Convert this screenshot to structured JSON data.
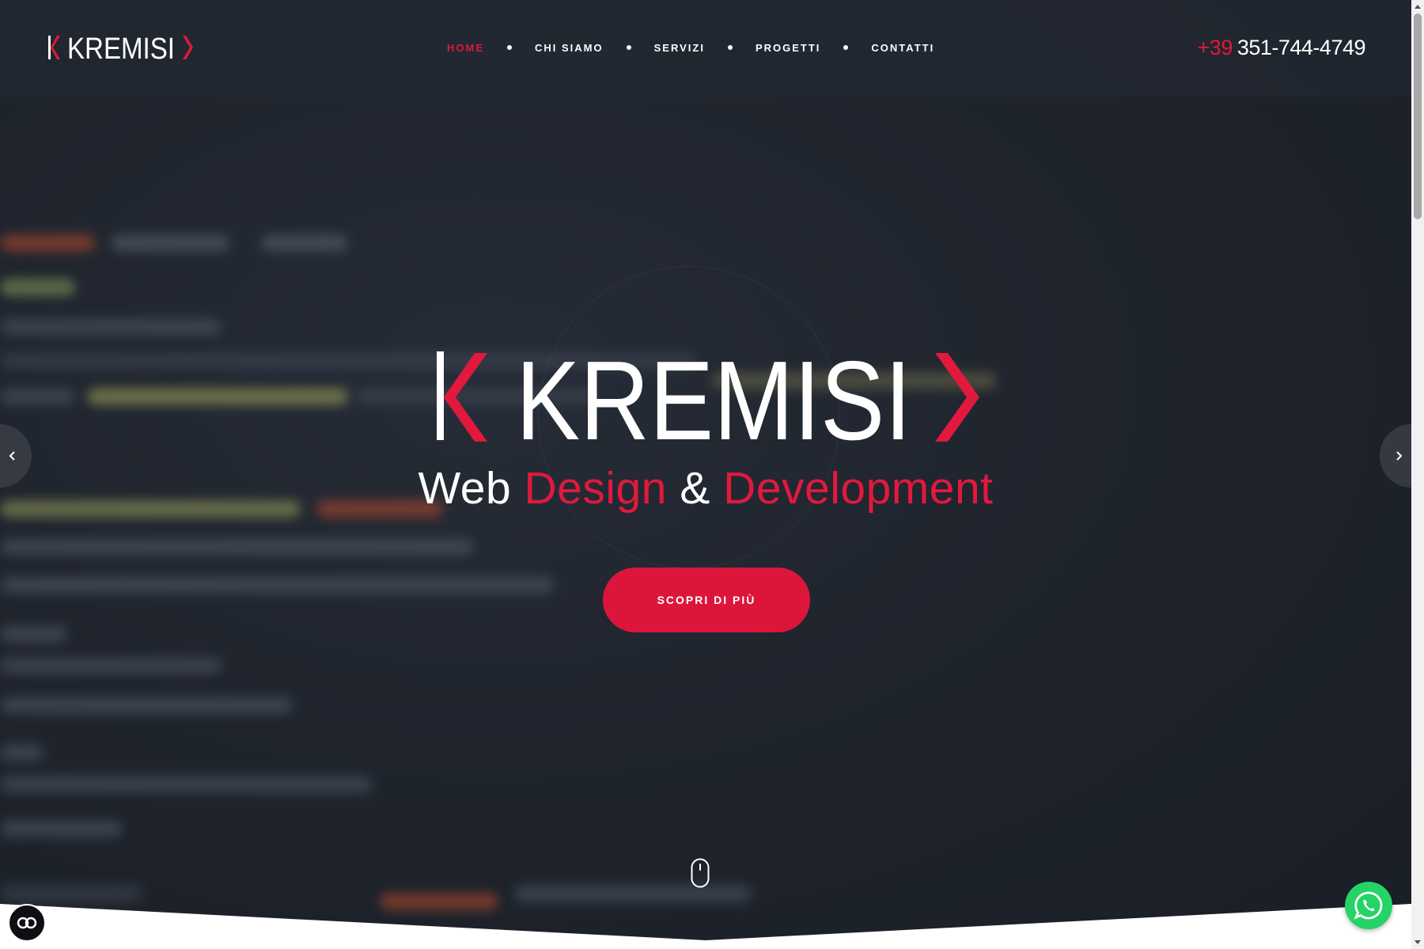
{
  "header": {
    "logo_text": "KREMISI",
    "nav": [
      {
        "label": "HOME",
        "active": true
      },
      {
        "label": "CHI SIAMO",
        "active": false
      },
      {
        "label": "SERVIZI",
        "active": false
      },
      {
        "label": "PROGETTI",
        "active": false
      },
      {
        "label": "CONTATTI",
        "active": false
      }
    ],
    "phone_prefix": "+39",
    "phone_number": "351-744-4749"
  },
  "hero": {
    "logo_text": "KREMISI",
    "tagline": {
      "w1": "Web",
      "w2": "Design",
      "w3": "&",
      "w4": "Development"
    },
    "cta_label": "SCOPRI DI PIÙ",
    "prev_icon": "chevron-left-icon",
    "next_icon": "chevron-right-icon",
    "scroll_icon": "mouse-scroll-icon"
  },
  "floating": {
    "accessibility_icon": "accessibility-icon",
    "whatsapp_icon": "whatsapp-icon"
  },
  "colors": {
    "accent": "#e0193d",
    "background": "#1c212b",
    "text": "#ffffff",
    "whatsapp": "#25d366"
  }
}
